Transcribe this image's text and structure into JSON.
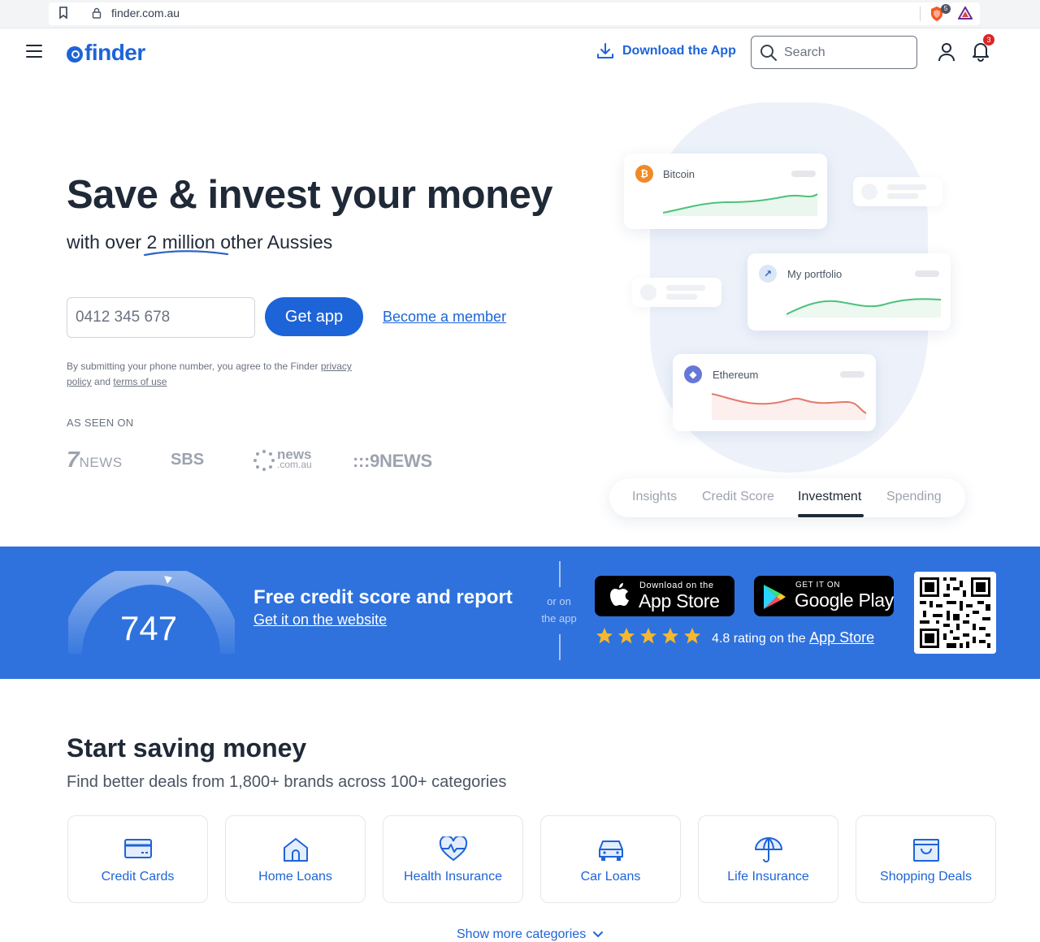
{
  "browser": {
    "url": "finder.com.au",
    "shield_count": "5"
  },
  "header": {
    "logo_text": "finder",
    "download_app": "Download the App",
    "search_placeholder": "Search",
    "notification_count": "3"
  },
  "hero": {
    "title": "Save & invest your money",
    "subtitle_before": "with over",
    "subtitle_highlight": "2 million",
    "subtitle_after": "other Aussies",
    "phone_placeholder": "0412 345 678",
    "get_app": "Get app",
    "become_member": "Become a member",
    "disclaimer_prefix": "By submitting your phone number, you agree to the Finder",
    "disclaimer_privacy": "privacy policy",
    "disclaimer_and": "and",
    "disclaimer_terms": "terms of use",
    "as_seen_on": "AS SEEN ON",
    "media": [
      {
        "name": "7NEWS",
        "parts": [
          "7",
          "NEWS"
        ]
      },
      {
        "name": "SBS",
        "text": "SBS"
      },
      {
        "name": "news.com.au",
        "parts": [
          "news",
          ".com.au"
        ]
      },
      {
        "name": "9NEWS",
        "text": ":::9NEWS"
      }
    ]
  },
  "illustration": {
    "cards": [
      {
        "label": "Bitcoin",
        "icon": "bitcoin-icon",
        "icon_glyph": "₿",
        "color": "#f08a24",
        "trend": "up"
      },
      {
        "label": "My portfolio",
        "icon": "trend-icon",
        "icon_glyph": "↗",
        "color": "#dbe6f6",
        "trend": "up"
      },
      {
        "label": "Ethereum",
        "icon": "ethereum-icon",
        "icon_glyph": "◆",
        "color": "#6678d6",
        "trend": "down"
      }
    ],
    "tabs": [
      "Insights",
      "Credit Score",
      "Investment",
      "Spending"
    ],
    "active_tab": "Investment"
  },
  "band": {
    "score": "747",
    "title": "Free credit score and report",
    "link": "Get it on the website",
    "or_on": "or on",
    "the_app": "the app",
    "appstore_small": "Download on the",
    "appstore_big": "App Store",
    "googleplay_small": "GET IT ON",
    "googleplay_big": "Google Play",
    "stars": 5,
    "rating_text": "4.8 rating on the",
    "rating_link": "App Store",
    "star_color": "#f5b82e"
  },
  "saving": {
    "title": "Start saving money",
    "subtitle": "Find better deals from 1,800+ brands across 100+ categories",
    "categories": [
      {
        "label": "Credit Cards",
        "icon": "credit-card-icon"
      },
      {
        "label": "Home Loans",
        "icon": "house-icon"
      },
      {
        "label": "Health Insurance",
        "icon": "heart-pulse-icon"
      },
      {
        "label": "Car Loans",
        "icon": "car-icon"
      },
      {
        "label": "Life Insurance",
        "icon": "umbrella-icon"
      },
      {
        "label": "Shopping Deals",
        "icon": "shopping-bag-icon"
      }
    ],
    "show_more": "Show more categories"
  },
  "colors": {
    "brand": "#1d64d8",
    "band": "#2f72dd",
    "text": "#1f2937"
  }
}
